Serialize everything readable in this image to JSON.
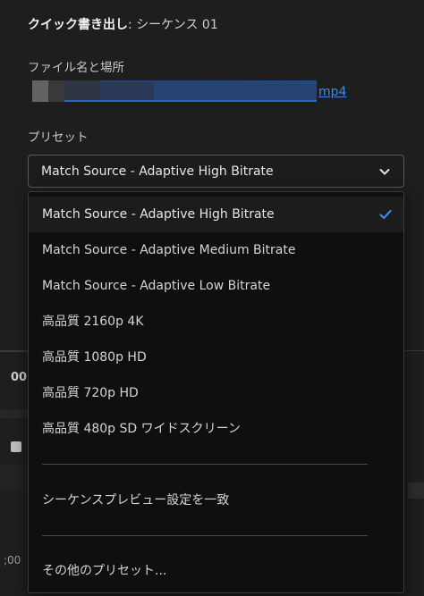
{
  "header": {
    "title_bold": "クイック書き出し",
    "title_rest": ": シーケンス 01"
  },
  "filename": {
    "label": "ファイル名と場所",
    "extension": "mp4"
  },
  "preset": {
    "label": "プリセット",
    "selected": "Match Source - Adaptive High Bitrate"
  },
  "dropdown": {
    "options": [
      "Match Source - Adaptive High Bitrate",
      "Match Source - Adaptive Medium Bitrate",
      "Match Source - Adaptive Low Bitrate",
      "高品質 2160p 4K",
      "高品質 1080p HD",
      "高品質 720p HD",
      "高品質 480p SD ワイドスクリーン"
    ],
    "match_sequence": "シーケンスプレビュー設定を一致",
    "more_presets": "その他のプリセット..."
  },
  "background": {
    "timecode_fragment": "00",
    "timecode_fragment_2": ";00"
  },
  "colors": {
    "accent": "#3d8ae8",
    "panel": "#1e1e1e",
    "menu": "#0f0f0f"
  },
  "icons": {
    "select_chevron": "chevron-down-icon",
    "selected_check": "checkmark-icon"
  }
}
